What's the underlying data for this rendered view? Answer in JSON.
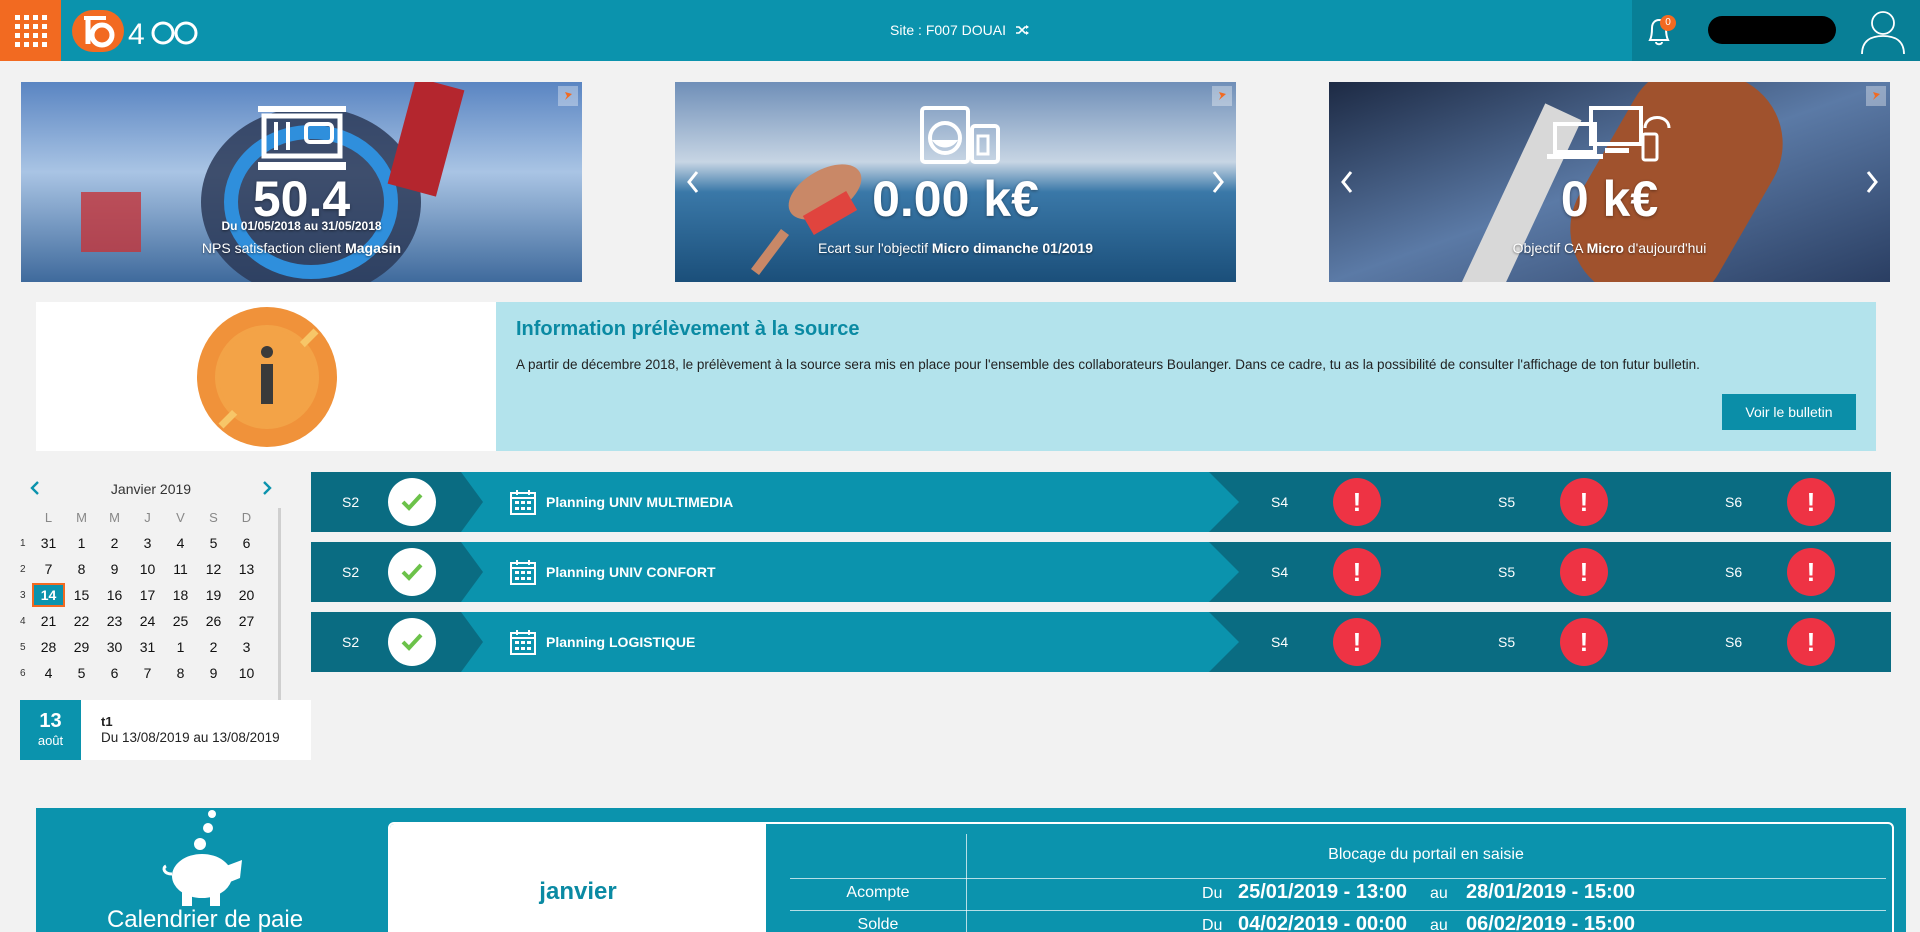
{
  "header": {
    "logo_text": "b400",
    "site_label": "Site : F007 DOUAI",
    "notification_count": "0"
  },
  "banners": [
    {
      "value": "50.4",
      "period": "Du 01/05/2018 au 31/05/2018",
      "caption_prefix": "NPS satisfaction client ",
      "caption_bold": "Magasin",
      "caption_suffix": "",
      "icon": "cash-register-icon"
    },
    {
      "value": "0.00 k€",
      "period": "",
      "caption_prefix": "Ecart sur l'objectif ",
      "caption_bold": "Micro dimanche 01/2019",
      "caption_suffix": "",
      "icon": "appliances-icon"
    },
    {
      "value": "0 k€",
      "period": "",
      "caption_prefix": "Objectif CA ",
      "caption_bold": "Micro",
      "caption_suffix": " d'aujourd'hui",
      "icon": "devices-icon"
    }
  ],
  "info": {
    "title": "Information prélèvement à la source",
    "text": "A partir de décembre 2018, le prélèvement à la source sera mis en place pour l'ensemble des collaborateurs Boulanger. Dans ce cadre, tu as la possibilité de consulter l'affichage de ton futur bulletin.",
    "button": "Voir le bulletin"
  },
  "calendar": {
    "month": "Janvier 2019",
    "day_headers": [
      "L",
      "M",
      "M",
      "J",
      "V",
      "S",
      "D"
    ],
    "weeks": [
      {
        "wk": "1",
        "days": [
          "31",
          "1",
          "2",
          "3",
          "4",
          "5",
          "6"
        ]
      },
      {
        "wk": "2",
        "days": [
          "7",
          "8",
          "9",
          "10",
          "11",
          "12",
          "13"
        ]
      },
      {
        "wk": "3",
        "days": [
          "14",
          "15",
          "16",
          "17",
          "18",
          "19",
          "20"
        ]
      },
      {
        "wk": "4",
        "days": [
          "21",
          "22",
          "23",
          "24",
          "25",
          "26",
          "27"
        ]
      },
      {
        "wk": "5",
        "days": [
          "28",
          "29",
          "30",
          "31",
          "1",
          "2",
          "3"
        ]
      },
      {
        "wk": "6",
        "days": [
          "4",
          "5",
          "6",
          "7",
          "8",
          "9",
          "10"
        ]
      }
    ],
    "today": "14"
  },
  "event": {
    "day": "13",
    "month": "août",
    "title": "t1",
    "range": "Du 13/08/2019 au 13/08/2019"
  },
  "plannings": [
    {
      "first_week": "S2",
      "title": "Planning UNIV MULTIMEDIA",
      "weeks": [
        "S4",
        "S5",
        "S6"
      ]
    },
    {
      "first_week": "S2",
      "title": "Planning UNIV CONFORT",
      "weeks": [
        "S4",
        "S5",
        "S6"
      ]
    },
    {
      "first_week": "S2",
      "title": "Planning LOGISTIQUE",
      "weeks": [
        "S4",
        "S5",
        "S6"
      ]
    }
  ],
  "payroll": {
    "title": "Calendrier de paie",
    "month": "janvier",
    "header": "Blocage du portail en saisie",
    "rows": [
      {
        "label": "Acompte",
        "du": "Du",
        "from": "25/01/2019 - 13:00",
        "au": "au",
        "to": "28/01/2019 - 15:00"
      },
      {
        "label": "Solde",
        "du": "Du",
        "from": "04/02/2019 - 00:00",
        "au": "au",
        "to": "06/02/2019 - 15:00"
      }
    ]
  },
  "colors": {
    "primary": "#0b93ad",
    "dark": "#0a6c82",
    "accent": "#f26a21",
    "alert": "#ee3344",
    "info_bg": "#b3e3ec"
  }
}
